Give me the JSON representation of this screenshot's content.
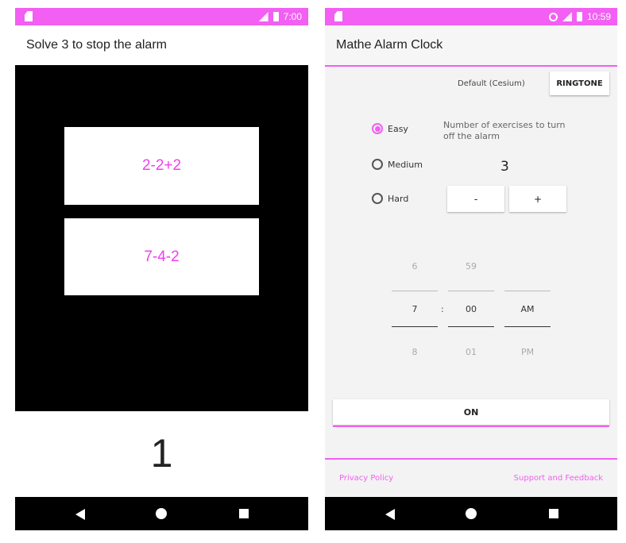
{
  "left": {
    "status": {
      "time": "7:00"
    },
    "title": "Solve 3 to stop the alarm",
    "equations": [
      "2-2+2",
      "7-4-2"
    ],
    "solved_count": "1"
  },
  "right": {
    "status": {
      "time": "10:59"
    },
    "title": "Mathe Alarm Clock",
    "ringtone": {
      "current": "Default (Cesium)",
      "button": "RINGTONE"
    },
    "difficulty": {
      "options": [
        "Easy",
        "Medium",
        "Hard"
      ],
      "selected": "Easy"
    },
    "exercises": {
      "label": "Number of exercises to turn off the alarm",
      "count": "3",
      "minus": "-",
      "plus": "+"
    },
    "time_picker": {
      "hour": {
        "prev": "6",
        "current": "7",
        "next": "8"
      },
      "separator": ":",
      "minute": {
        "prev": "59",
        "current": "00",
        "next": "01"
      },
      "ampm": {
        "current": "AM",
        "next": "PM"
      }
    },
    "toggle_button": "ON",
    "footer": {
      "privacy": "Privacy Policy",
      "support": "Support and Feedback"
    }
  },
  "colors": {
    "accent": "#f25ff2",
    "equation_text": "#f03ff0"
  }
}
